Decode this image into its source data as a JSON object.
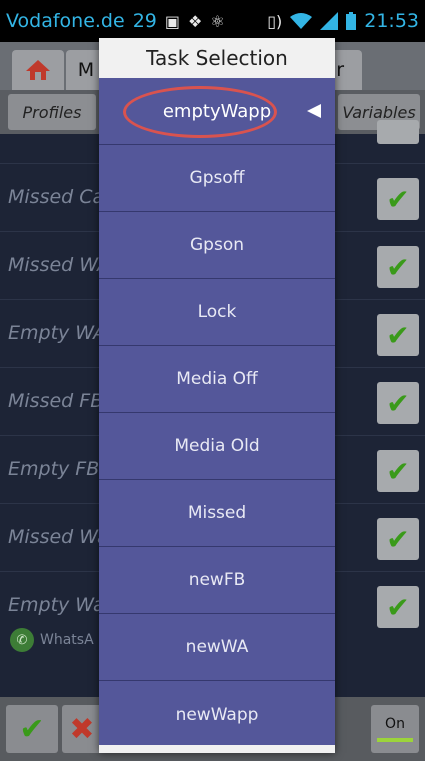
{
  "status_bar": {
    "carrier": "Vodafone.de",
    "notification_count": "29",
    "time": "21:53",
    "icons": [
      "image-icon",
      "dropbox-icon",
      "tasker-icon",
      "vibrate-icon",
      "wifi-icon",
      "signal-icon",
      "battery-icon"
    ]
  },
  "app": {
    "tab_m": "M",
    "tab_r": "r",
    "subtabs": {
      "profiles": "Profiles",
      "variables": "Variables"
    },
    "rows": [
      "Missed Ca",
      "Missed WA",
      "Empty WA",
      "Missed FB",
      "Empty FB",
      "Missed Wa",
      "Empty Wa"
    ],
    "whatsapp_label": "WhatsA",
    "on_button": "On"
  },
  "dialog": {
    "title": "Task Selection",
    "items": [
      "emptyWapp",
      "Gpsoff",
      "Gpson",
      "Lock",
      "Media Off",
      "Media Old",
      "Missed",
      "newFB",
      "newWA",
      "newWapp"
    ],
    "highlight_color": "#d9534f"
  }
}
